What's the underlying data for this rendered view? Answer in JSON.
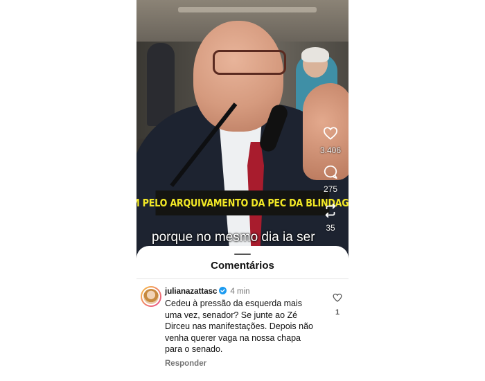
{
  "video": {
    "banner_text": "SIM PELO ARQUIVAMENTO DA PEC DA BLINDAGEM",
    "subtitle_text": "porque no mesmo dia ia ser",
    "actions": {
      "like_icon": "heart-icon",
      "like_count": "3.406",
      "comment_icon": "comment-bubble-icon",
      "comment_count": "275",
      "repost_icon": "repost-icon",
      "repost_count": "35"
    }
  },
  "comments_sheet": {
    "title": "Comentários",
    "comments": [
      {
        "username": "julianazattasc",
        "verified": true,
        "time": "4 min",
        "text": "Cedeu à pressão da esquerda mais uma vez, senador? Se junte ao Zé Dirceu nas manifestações. Depois não venha querer vaga na nossa chapa para o senado.",
        "reply_label": "Responder",
        "like_count": "1"
      }
    ]
  },
  "colors": {
    "banner_bg": "#141411",
    "banner_text": "#f2e826",
    "verified_blue": "#1d9bf0"
  }
}
